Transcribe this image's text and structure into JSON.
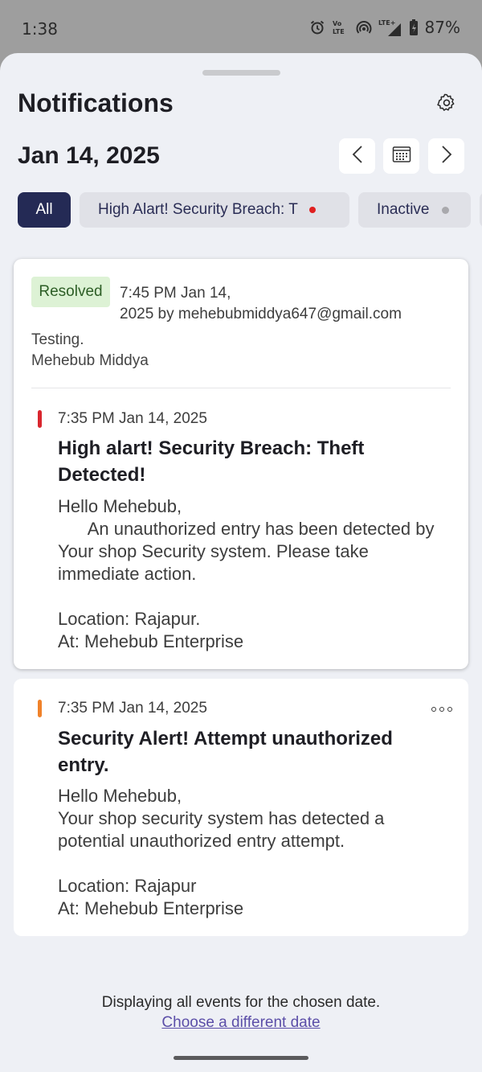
{
  "status_bar": {
    "time": "1:38",
    "battery": "87%",
    "icons": [
      "alarm-icon",
      "volte-icon",
      "hotspot-icon",
      "lte-signal-icon",
      "battery-icon"
    ]
  },
  "header": {
    "title": "Notifications",
    "settings_icon": "gear-icon"
  },
  "date_nav": {
    "date": "Jan 14, 2025",
    "prev_icon": "chevron-left-icon",
    "calendar_icon": "calendar-icon",
    "next_icon": "chevron-right-icon"
  },
  "filters": [
    {
      "label": "All",
      "selected": true
    },
    {
      "label": "High Alart! Security Breach: T",
      "dot_color": "#e02020"
    },
    {
      "label": "Inactive",
      "dot_color": "#a9a9ad"
    }
  ],
  "events": [
    {
      "resolution": {
        "badge": "Resolved",
        "meta_line1": "7:45 PM Jan 14,",
        "meta_line2": "2025 by mehebubmiddya647@gmail.com",
        "comment_line1": "Testing.",
        "comment_line2": "Mehebub Middya"
      },
      "indicator_color": "#d9262e",
      "time": "7:35 PM Jan 14, 2025",
      "title": "High alart! Security Breach: Theft Detected!",
      "body": "Hello Mehebub,\n      An unauthorized entry has been detected by Your shop Security system. Please take immediate action.\n\nLocation: Rajapur.\nAt: Mehebub Enterprise"
    },
    {
      "indicator_color": "#f0822a",
      "time": "7:35 PM Jan 14, 2025",
      "title": "Security Alert! Attempt unauthorized entry.",
      "body": "Hello Mehebub,\nYour shop security system has detected a potential unauthorized entry attempt.\n\nLocation: Rajapur\nAt: Mehebub Enterprise",
      "menu_icon": "more-horizontal-icon"
    }
  ],
  "footer": {
    "text": "Displaying all events for the chosen date.",
    "link": "Choose a different date"
  }
}
